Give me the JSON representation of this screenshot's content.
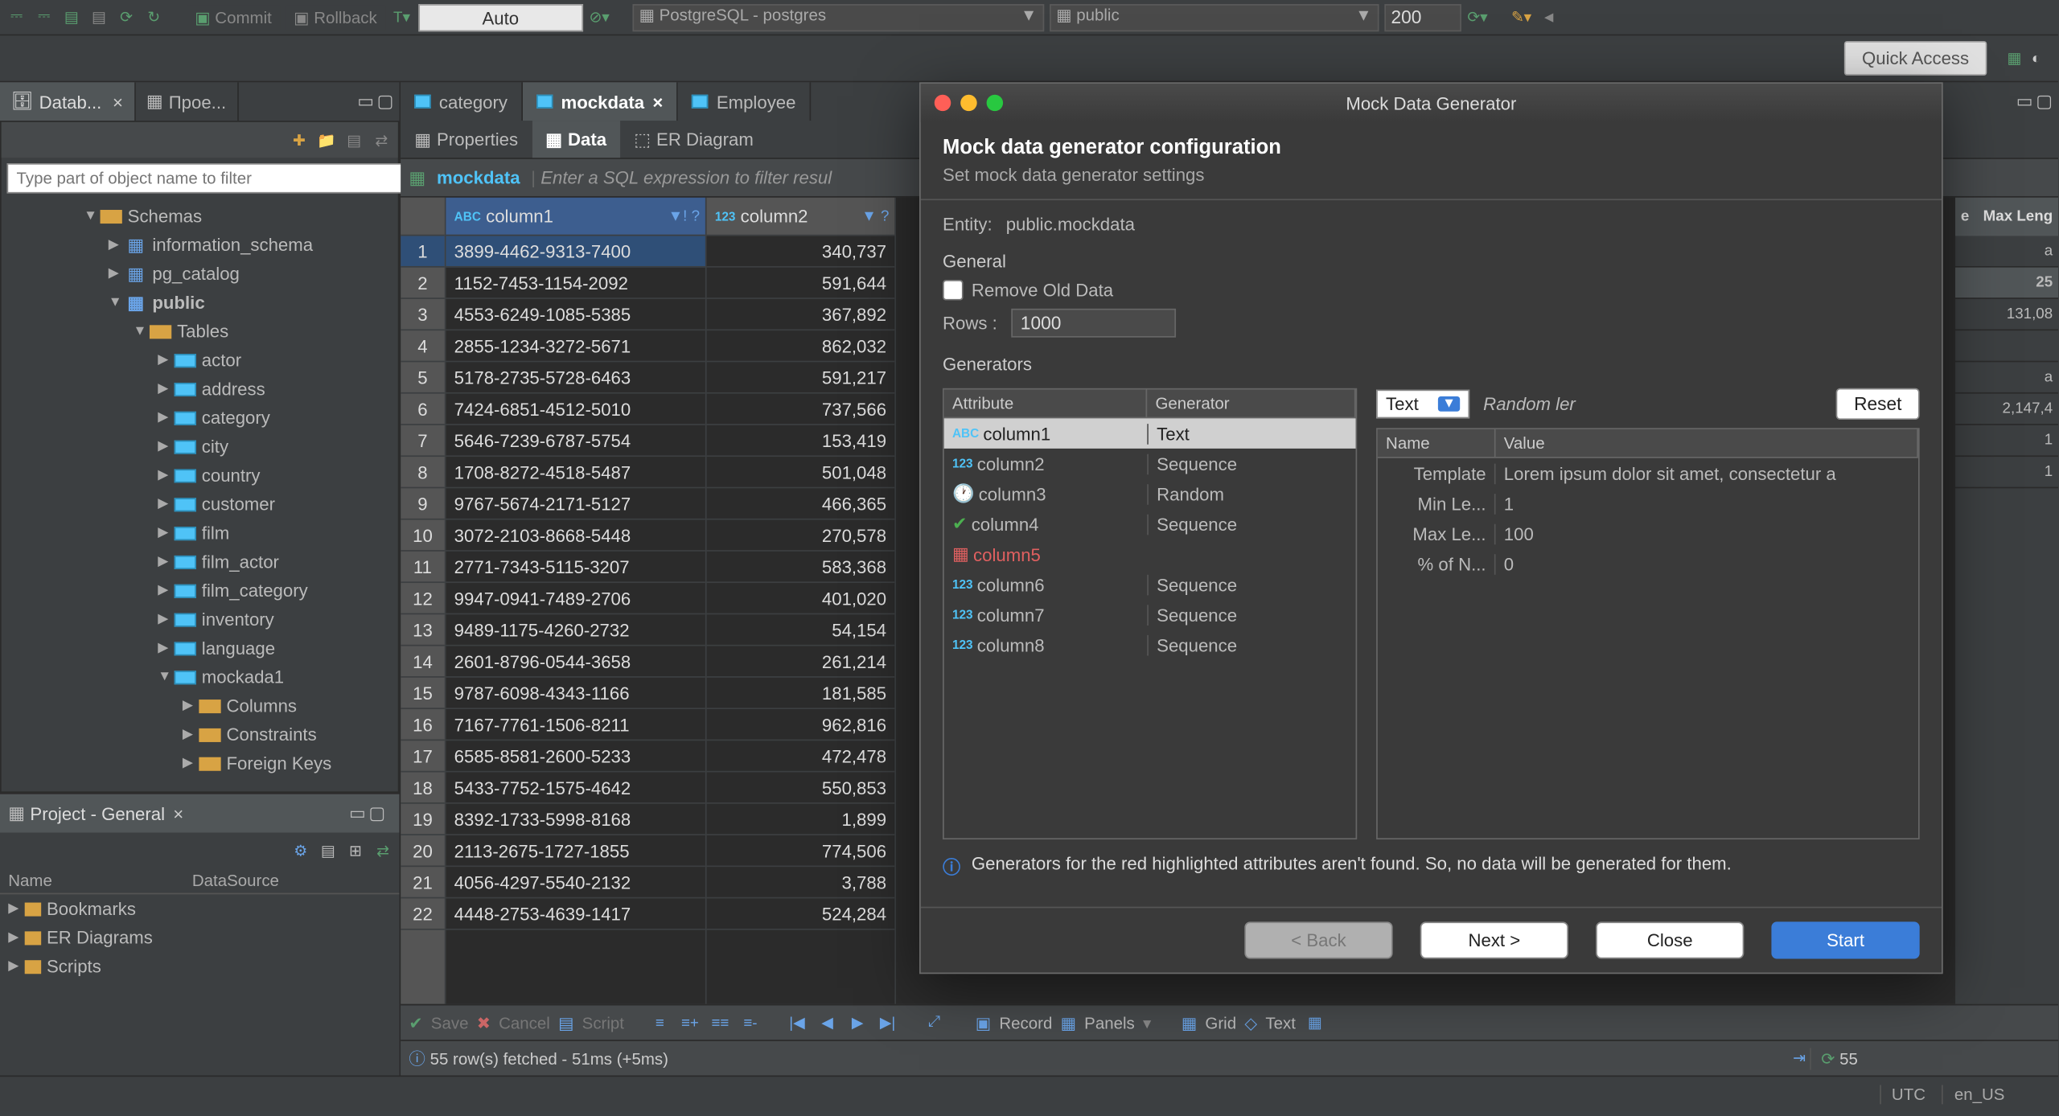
{
  "toolbar": {
    "commit": "Commit",
    "rollback": "Rollback",
    "auto": "Auto",
    "datasource": "PostgreSQL - postgres",
    "schema": "public",
    "limit": "200",
    "quick_access": "Quick Access"
  },
  "left_tabs": {
    "database": "Datab...",
    "project": "Прое..."
  },
  "filter_placeholder": "Type part of object name to filter",
  "tree": {
    "schemas": "Schemas",
    "items": [
      "information_schema",
      "pg_catalog",
      "public"
    ],
    "tables_label": "Tables",
    "tables": [
      "actor",
      "address",
      "category",
      "city",
      "country",
      "customer",
      "film",
      "film_actor",
      "film_category",
      "inventory",
      "language",
      "mockada1"
    ],
    "sub": [
      "Columns",
      "Constraints",
      "Foreign Keys"
    ]
  },
  "project": {
    "title": "Project - General",
    "cols": [
      "Name",
      "DataSource"
    ],
    "items": [
      "Bookmarks",
      "ER Diagrams",
      "Scripts"
    ]
  },
  "editor_tabs": [
    "category",
    "mockdata",
    "Employee"
  ],
  "sub_tabs": [
    "Properties",
    "Data",
    "ER Diagram"
  ],
  "table_name": "mockdata",
  "filter_expr": "Enter a SQL expression to filter resul",
  "cols": [
    "column1",
    "column2"
  ],
  "rows": [
    [
      "3899-4462-9313-7400",
      "340,737"
    ],
    [
      "1152-7453-1154-2092",
      "591,644"
    ],
    [
      "4553-6249-1085-5385",
      "367,892"
    ],
    [
      "2855-1234-3272-5671",
      "862,032"
    ],
    [
      "5178-2735-5728-6463",
      "591,217"
    ],
    [
      "7424-6851-4512-5010",
      "737,566"
    ],
    [
      "5646-7239-6787-5754",
      "153,419"
    ],
    [
      "1708-8272-4518-5487",
      "501,048"
    ],
    [
      "9767-5674-2171-5127",
      "466,365"
    ],
    [
      "3072-2103-8668-5448",
      "270,578"
    ],
    [
      "2771-7343-5115-3207",
      "583,368"
    ],
    [
      "9947-0941-7489-2706",
      "401,020"
    ],
    [
      "9489-1175-4260-2732",
      "54,154"
    ],
    [
      "2601-8796-0544-3658",
      "261,214"
    ],
    [
      "9787-6098-4343-1166",
      "181,585"
    ],
    [
      "7167-7761-1506-8211",
      "962,816"
    ],
    [
      "6585-8581-2600-5233",
      "472,478"
    ],
    [
      "5433-7752-1575-4642",
      "550,853"
    ],
    [
      "8392-1733-5998-8168",
      "1,899"
    ],
    [
      "2113-2675-1727-1855",
      "774,506"
    ],
    [
      "4056-4297-5540-2132",
      "3,788"
    ],
    [
      "4448-2753-4639-1417",
      "524,284"
    ]
  ],
  "right_props": {
    "header1": "e",
    "header2": "Max Leng",
    "vals": [
      "a",
      "25",
      "131,08",
      "",
      "a",
      "2,147,4",
      "1",
      "1"
    ]
  },
  "bottom": {
    "save": "Save",
    "cancel": "Cancel",
    "script": "Script",
    "record": "Record",
    "panels": "Panels",
    "grid": "Grid",
    "text": "Text",
    "status": "55 row(s) fetched - 51ms (+5ms)",
    "count": "55"
  },
  "dialog": {
    "title": "Mock Data Generator",
    "h1": "Mock data generator configuration",
    "h2": "Set mock data generator settings",
    "entity_lbl": "Entity:",
    "entity": "public.mockdata",
    "general": "General",
    "remove_old": "Remove Old Data",
    "rows_lbl": "Rows :",
    "rows_val": "1000",
    "generators_lbl": "Generators",
    "attr_head": "Attribute",
    "gen_head": "Generator",
    "attrs": [
      {
        "name": "column1",
        "gen": "Text",
        "type": "abc",
        "sel": true
      },
      {
        "name": "column2",
        "gen": "Sequence",
        "type": "123"
      },
      {
        "name": "column3",
        "gen": "Random",
        "type": "clock"
      },
      {
        "name": "column4",
        "gen": "Sequence",
        "type": "check"
      },
      {
        "name": "column5",
        "gen": "",
        "type": "red",
        "red": true
      },
      {
        "name": "column6",
        "gen": "Sequence",
        "type": "123"
      },
      {
        "name": "column7",
        "gen": "Sequence",
        "type": "123"
      },
      {
        "name": "column8",
        "gen": "Sequence",
        "type": "123"
      }
    ],
    "type_sel": "Text",
    "random_lbl": "Random ler",
    "reset": "Reset",
    "prop_name": "Name",
    "prop_val": "Value",
    "props": [
      {
        "n": "Template",
        "v": "Lorem ipsum dolor sit amet, consectetur a"
      },
      {
        "n": "Min Le...",
        "v": "1"
      },
      {
        "n": "Max Le...",
        "v": "100"
      },
      {
        "n": "% of N...",
        "v": "0"
      }
    ],
    "info": "Generators for the red highlighted attributes aren't found. So, no data will be generated for them.",
    "back": "< Back",
    "next": "Next >",
    "close": "Close",
    "start": "Start"
  },
  "status": {
    "tz": "UTC",
    "locale": "en_US"
  }
}
